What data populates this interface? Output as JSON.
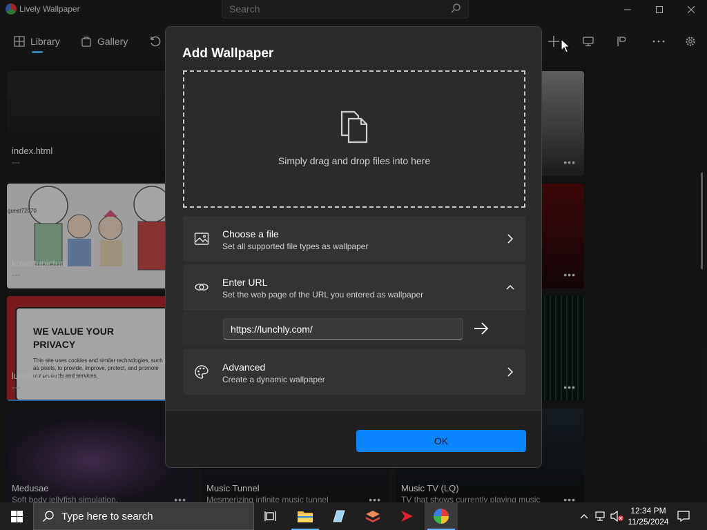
{
  "app": {
    "title": "Lively Wallpaper"
  },
  "search": {
    "placeholder": "Search"
  },
  "nav": {
    "library": "Library",
    "gallery": "Gallery"
  },
  "tiles": [
    {
      "title": "index.html",
      "desc": "---"
    },
    {
      "title": "kuvertupicture",
      "desc": "---"
    },
    {
      "title": "lunchly.com",
      "desc": "---"
    },
    {
      "title": "Medusae",
      "desc": "Soft body jellyfish simulation."
    },
    {
      "title": "Music Tunnel",
      "desc": "Mesmerizing infinite music tunnel"
    },
    {
      "title": "Music TV (LQ)",
      "desc": "TV that shows currently playing music"
    }
  ],
  "thumbs": {
    "guest": "guest72070",
    "privacy_heading": "WE VALUE YOUR PRIVACY",
    "privacy_body": "This site uses cookies and similar technologies, such as pixels, to provide, improve, protect, and promote our products and services."
  },
  "dialog": {
    "title": "Add Wallpaper",
    "drop_text": "Simply drag and drop files into here",
    "choose_file": {
      "title": "Choose a file",
      "subtitle": "Set all supported file types as wallpaper"
    },
    "enter_url": {
      "title": "Enter URL",
      "subtitle": "Set the web page of the URL you entered as wallpaper",
      "value": "https://lunchly.com/"
    },
    "advanced": {
      "title": "Advanced",
      "subtitle": "Create a dynamic wallpaper"
    },
    "ok_label": "OK"
  },
  "taskbar": {
    "search_text": "Type here to search",
    "time": "12:34 PM",
    "date": "11/25/2024"
  },
  "colors": {
    "accent": "#0a84ff",
    "nav_indicator": "#4cc2ff"
  }
}
